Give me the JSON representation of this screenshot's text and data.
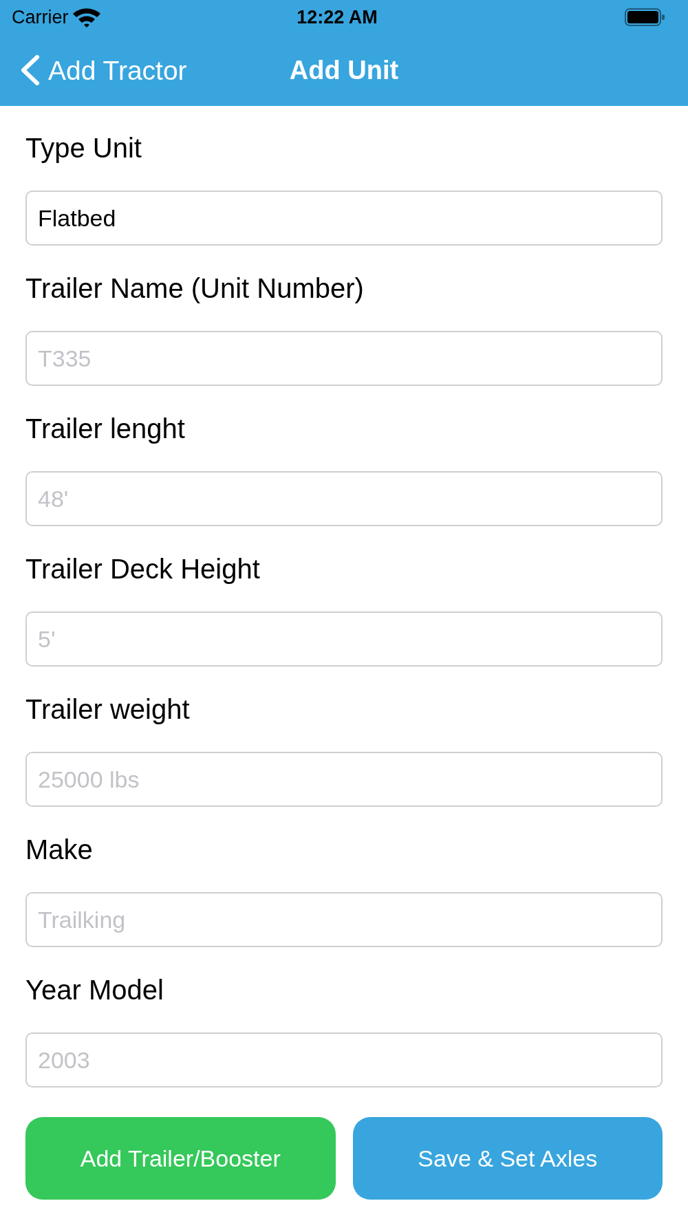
{
  "status_bar": {
    "carrier": "Carrier",
    "time": "12:22 AM"
  },
  "nav_bar": {
    "back_label": "Add Tractor",
    "title": "Add Unit"
  },
  "fields": [
    {
      "label": "Type Unit",
      "value": "Flatbed"
    },
    {
      "label": "Trailer Name (Unit Number)",
      "placeholder": "T335"
    },
    {
      "label": "Trailer lenght",
      "placeholder": "48'"
    },
    {
      "label": "Trailer Deck Height",
      "placeholder": "5'"
    },
    {
      "label": "Trailer weight",
      "placeholder": "25000 lbs"
    },
    {
      "label": "Make",
      "placeholder": "Trailking"
    },
    {
      "label": "Year Model",
      "placeholder": "2003"
    }
  ],
  "buttons": [
    {
      "label": "Add Trailer/Booster",
      "kind": "add"
    },
    {
      "label": "Save & Set Axles",
      "kind": "save"
    }
  ]
}
